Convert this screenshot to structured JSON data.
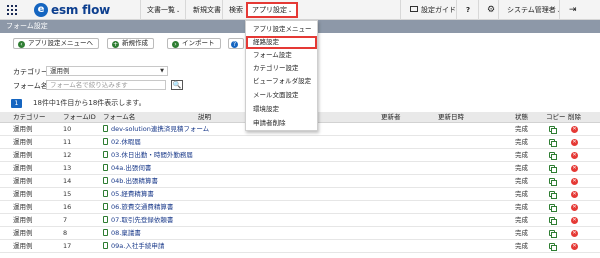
{
  "app": {
    "logo_letter": "e",
    "logo_text": "esm flow",
    "brand_color": "#1565c0"
  },
  "nav": {
    "docs_list": "文書一覧",
    "new_doc": "新規文書",
    "search": "検索",
    "app_settings": "アプリ設定",
    "settings_guide": "設定ガイド",
    "help": "?",
    "admin": "システム管理者",
    "caret": "⌄",
    "gear": "⚙",
    "logout": "⇥"
  },
  "subbar": {
    "title": "フォーム設定"
  },
  "toolbar": {
    "back_menu": "アプリ設定メニューへ",
    "new_create": "新規作成",
    "import": "インポート"
  },
  "filters": {
    "category_label": "カテゴリー：",
    "category_value": "運用例",
    "form_name_label": "フォーム名：",
    "form_name_placeholder": "フォーム名で絞り込みます",
    "search_icon": "🔍"
  },
  "paging": {
    "page": "1",
    "summary": "18件中1件目から18件表示します。"
  },
  "table": {
    "headers": [
      "カテゴリー",
      "フォームID",
      "フォーム名",
      "説明",
      "更新者",
      "更新日時",
      "状態",
      "コピー",
      "削除"
    ],
    "rows": [
      {
        "category": "運用例",
        "id": "10",
        "name": "dev-solution連携済見積フォーム",
        "status": "完成"
      },
      {
        "category": "運用例",
        "id": "11",
        "name": "02.休暇届",
        "status": "完成"
      },
      {
        "category": "運用例",
        "id": "12",
        "name": "03.休日出勤・時間外勤務届",
        "status": "完成"
      },
      {
        "category": "運用例",
        "id": "13",
        "name": "04a.出張伺書",
        "status": "完成"
      },
      {
        "category": "運用例",
        "id": "14",
        "name": "04b.出張精算書",
        "status": "完成"
      },
      {
        "category": "運用例",
        "id": "15",
        "name": "05.経費精算書",
        "status": "完成"
      },
      {
        "category": "運用例",
        "id": "16",
        "name": "06.旅費交通費精算書",
        "status": "完成"
      },
      {
        "category": "運用例",
        "id": "7",
        "name": "07.取引先登録依頼書",
        "status": "完成"
      },
      {
        "category": "運用例",
        "id": "8",
        "name": "08.稟議書",
        "status": "完成"
      },
      {
        "category": "運用例",
        "id": "17",
        "name": "09a.入社手続申請",
        "status": "完成"
      }
    ]
  },
  "dropdown": {
    "items": [
      "アプリ設定メニュー",
      "経路設定",
      "フォーム設定",
      "カテゴリー設定",
      "ビューフォルダ設定",
      "メール文面設定",
      "環境設定",
      "申請者削除"
    ],
    "highlighted_index": 1
  }
}
